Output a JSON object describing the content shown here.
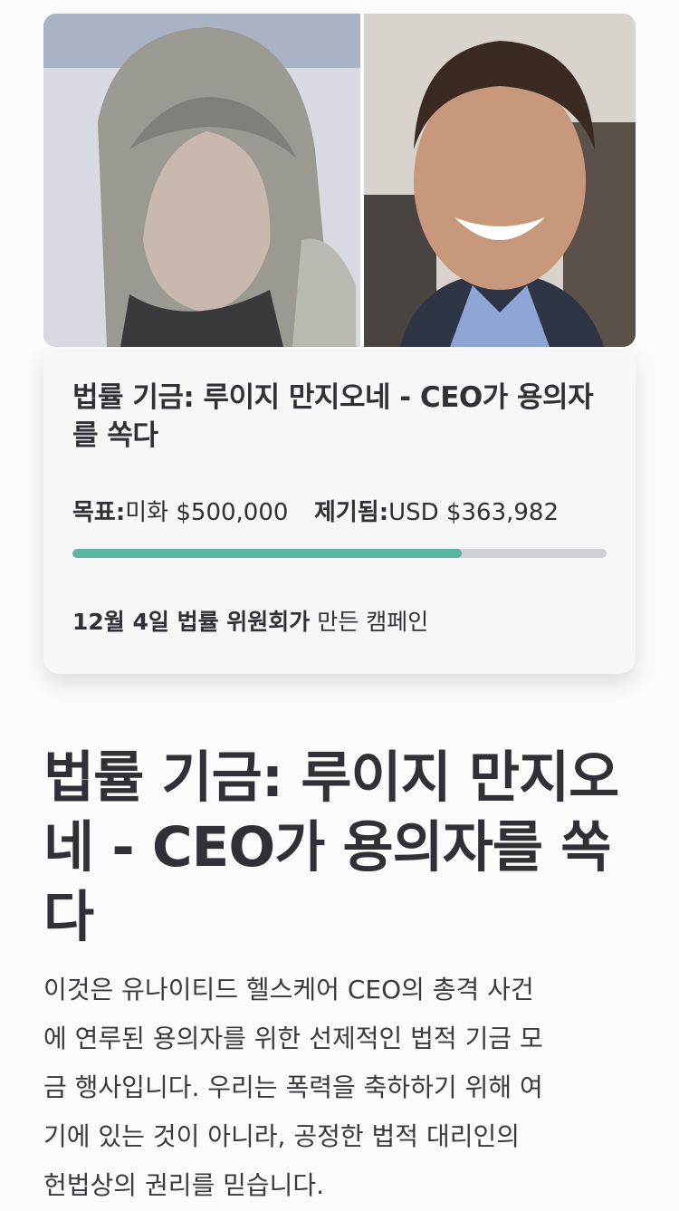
{
  "header_images": {
    "left_alt": "suspect-surveillance-photo",
    "right_alt": "suspect-portrait-photo"
  },
  "campaign_card": {
    "title": "법률 기금: 루이지 만지오네 - CEO가 용의자를 쏙다",
    "goal_label": "목표:",
    "goal_value": "미화 $500,000",
    "raised_label": "제기됨:",
    "raised_value": "USD $363,982",
    "progress_fraction": 0.728,
    "created_by_bold": "12월 4일 법률 위원회가",
    "created_by_rest": " 만든 캠페인"
  },
  "main_title": "법률 기금: 루이지 만지오네 - CEO가 용의자를 쏙다",
  "description": "이것은 유나이티드 헬스케어 CEO의 총격 사건에 연루된 용의자를 위한 선제적인 법적 기금 모금 행사입니다. 우리는 폭력을 축하하기 위해 여기에 있는 것이 아니라, 공정한 법적 대리인의 헌법상의 권리를 믿습니다.",
  "colors": {
    "progress_fill": "#5ab5a1",
    "progress_track": "#cfd1d6",
    "text": "#303036"
  }
}
